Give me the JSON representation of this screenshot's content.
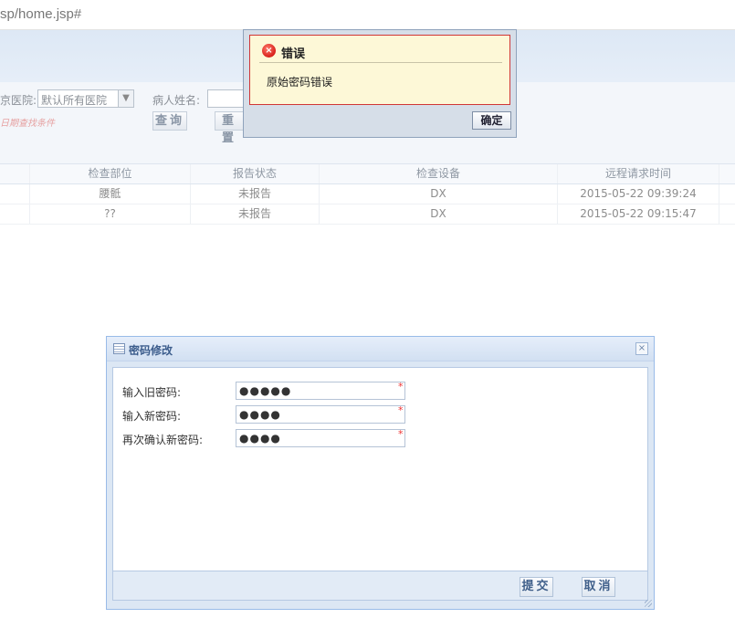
{
  "browser": {
    "url": "sp/home.jsp#"
  },
  "filters": {
    "hospital_label": "京医院:",
    "hospital_value": "默认所有医院",
    "patient_name_label": "病人姓名:",
    "hint": "日期查找条件",
    "query_button": "查询",
    "reset_button": "重置"
  },
  "grid": {
    "columns": [
      "",
      "检查部位",
      "报告状态",
      "检查设备",
      "远程请求时间"
    ],
    "rows": [
      [
        "",
        "腰骶",
        "未报告",
        "DX",
        "2015-05-22 09:39:24"
      ],
      [
        "",
        "??",
        "未报告",
        "DX",
        "2015-05-22 09:15:47"
      ]
    ]
  },
  "password_dialog": {
    "title": "密码修改",
    "old_label": "输入旧密码:",
    "old_value": "●●●●●",
    "new_label": "输入新密码:",
    "new_value": "●●●●",
    "confirm_label": "再次确认新密码:",
    "confirm_value": "●●●●",
    "required_mark": "*",
    "submit_button": "提交",
    "cancel_button": "取消",
    "close_symbol": "×"
  },
  "error_dialog": {
    "title": "错误",
    "icon_glyph": "×",
    "message": "原始密码错误",
    "ok_button": "确定"
  }
}
